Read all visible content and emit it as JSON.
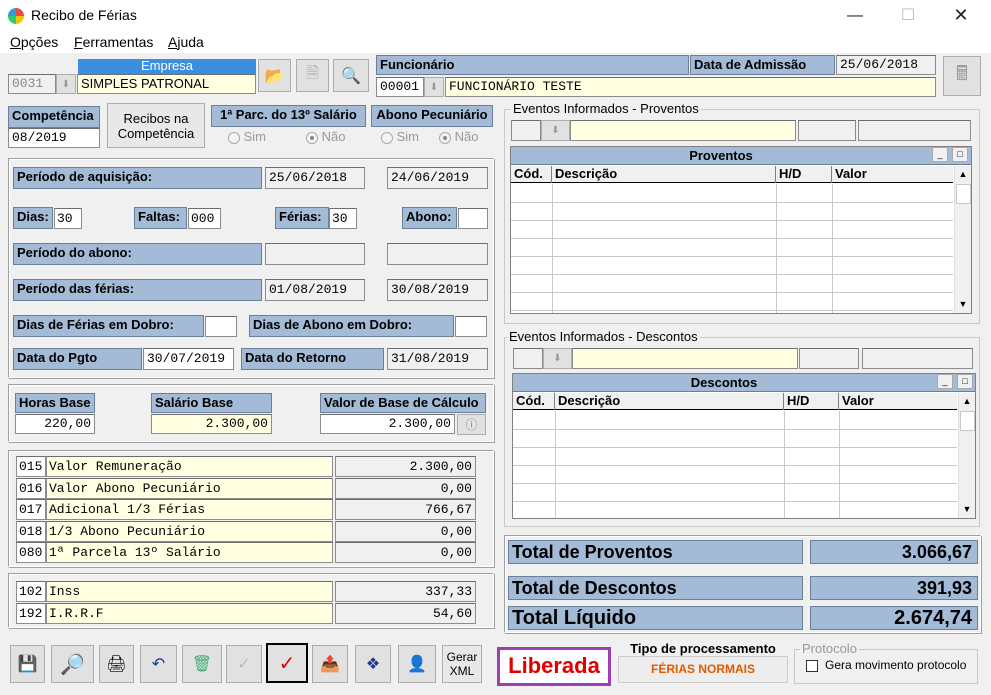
{
  "window": {
    "title": "Recibo de Férias"
  },
  "menu": {
    "opcoes": "pções",
    "opcoes_u": "O",
    "ferramentas": "erramentas",
    "ferramentas_u": "F",
    "ajuda": "juda",
    "ajuda_u": "A"
  },
  "empresa": {
    "label": "Empresa",
    "code": "0031",
    "name": "SIMPLES PATRONAL"
  },
  "funcionario": {
    "label": "Funcionário",
    "code": "00001",
    "name": "FUNCIONÁRIO TESTE",
    "admissao_label": "Data de Admissão",
    "admissao": "25/06/2018"
  },
  "competencia": {
    "label": "Competência",
    "value": "08/2019",
    "recibos_btn": "Recibos na Competência"
  },
  "parcela13": {
    "label": "1ª Parc. do 13º Salário",
    "sim": "Sim",
    "nao": "Não"
  },
  "abono": {
    "label": "Abono Pecuniário",
    "sim": "Sim",
    "nao": "Não"
  },
  "periodo_aquisicao": {
    "label": "Período de aquisição:",
    "inicio": "25/06/2018",
    "fim": "24/06/2019"
  },
  "dias": {
    "dias_label": "Dias:",
    "dias": "30",
    "faltas_label": "Faltas:",
    "faltas": "000",
    "ferias_label": "Férias:",
    "ferias": "30",
    "abono_label": "Abono:",
    "abono": ""
  },
  "periodo_abono": {
    "label": "Período do abono:",
    "inicio": "",
    "fim": ""
  },
  "periodo_ferias": {
    "label": "Período das férias:",
    "inicio": "01/08/2019",
    "fim": "30/08/2019"
  },
  "dobro": {
    "ferias_label": "Dias de Férias em Dobro:",
    "ferias": "",
    "abono_label": "Dias de Abono em Dobro:",
    "abono": ""
  },
  "datas": {
    "pgto_label": "Data do Pgto",
    "pgto": "30/07/2019",
    "retorno_label": "Data do Retorno",
    "retorno": "31/08/2019"
  },
  "base": {
    "horas_label": "Horas Base",
    "horas": "220,00",
    "salario_label": "Salário Base",
    "salario": "2.300,00",
    "calculo_label": "Valor de Base de Cálculo",
    "calculo": "2.300,00"
  },
  "verbas": [
    {
      "code": "015",
      "desc": "Valor Remuneração",
      "value": "2.300,00"
    },
    {
      "code": "016",
      "desc": "Valor Abono Pecuniário",
      "value": "0,00"
    },
    {
      "code": "017",
      "desc": "Adicional 1/3 Férias",
      "value": "766,67"
    },
    {
      "code": "018",
      "desc": "1/3 Abono Pecuniário",
      "value": "0,00"
    },
    {
      "code": "080",
      "desc": "1ª Parcela 13º Salário",
      "value": "0,00"
    }
  ],
  "descontos_fixos": [
    {
      "code": "102",
      "desc": "Inss",
      "value": "337,33"
    },
    {
      "code": "192",
      "desc": "I.R.R.F",
      "value": "54,60"
    }
  ],
  "eventos_proventos": {
    "legend": "Eventos Informados - Proventos",
    "grid_title": "Proventos",
    "cols": [
      "Cód.",
      "Descrição",
      "H/D",
      "Valor"
    ]
  },
  "eventos_descontos": {
    "legend": "Eventos Informados - Descontos",
    "grid_title": "Descontos",
    "cols": [
      "Cód.",
      "Descrição",
      "H/D",
      "Valor"
    ]
  },
  "totais": {
    "proventos_label": "Total de Proventos",
    "proventos": "3.066,67",
    "descontos_label": "Total de Descontos",
    "descontos": "391,93",
    "liquido_label": "Total Líquido",
    "liquido": "2.674,74"
  },
  "toolbar": {
    "gerar_xml": "Gerar XML"
  },
  "status": {
    "liberada": "Liberada",
    "tipo_label": "Tipo de processamento",
    "tipo_value": "FÉRIAS NORMAIS",
    "protocolo_legend": "Protocolo",
    "protocolo_check": "Gera movimento protocolo"
  }
}
